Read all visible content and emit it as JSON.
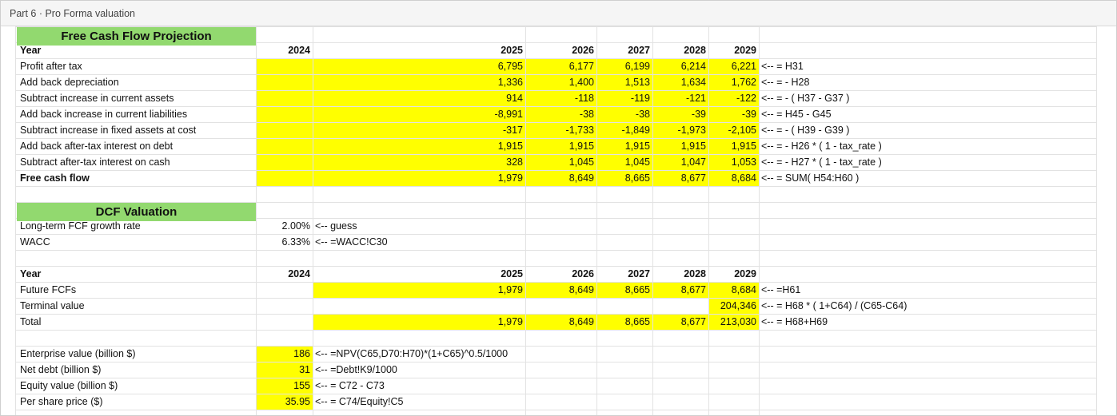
{
  "window": {
    "title": "Part 6 · Pro Forma valuation"
  },
  "fcf": {
    "header": "Free Cash Flow Projection",
    "year_label": "Year",
    "years": [
      "2024",
      "2025",
      "2026",
      "2027",
      "2028",
      "2029"
    ],
    "rows": [
      {
        "label": "Profit after tax",
        "values": [
          "6,795",
          "6,177",
          "6,199",
          "6,214",
          "6,221"
        ],
        "note": "<-- = H31"
      },
      {
        "label": "Add back depreciation",
        "values": [
          "1,336",
          "1,400",
          "1,513",
          "1,634",
          "1,762"
        ],
        "note": "<-- = - H28"
      },
      {
        "label": "Subtract increase in current assets",
        "values": [
          "914",
          "-118",
          "-119",
          "-121",
          "-122"
        ],
        "note": "<-- = - ( H37 - G37 )"
      },
      {
        "label": "Add back increase in current liabilities",
        "values": [
          "-8,991",
          "-38",
          "-38",
          "-39",
          "-39"
        ],
        "note": "<-- = H45 - G45"
      },
      {
        "label": "Subtract increase in fixed assets at cost",
        "values": [
          "-317",
          "-1,733",
          "-1,849",
          "-1,973",
          "-2,105"
        ],
        "note": "<-- = - ( H39 - G39 )"
      },
      {
        "label": "Add back after-tax interest on debt",
        "values": [
          "1,915",
          "1,915",
          "1,915",
          "1,915",
          "1,915"
        ],
        "note": "<-- = - H26 * ( 1 - tax_rate )"
      },
      {
        "label": "Subtract after-tax interest on cash",
        "values": [
          "328",
          "1,045",
          "1,045",
          "1,047",
          "1,053"
        ],
        "note": "<-- = - H27 * ( 1 - tax_rate )"
      },
      {
        "label": "Free cash flow",
        "values": [
          "1,979",
          "8,649",
          "8,665",
          "8,677",
          "8,684"
        ],
        "note": "<-- = SUM( H54:H60 )"
      }
    ]
  },
  "dcf": {
    "header": "DCF Valuation",
    "params": [
      {
        "label": "Long-term FCF growth rate",
        "value": "2.00%",
        "note": "<-- guess"
      },
      {
        "label": "WACC",
        "value": "6.33%",
        "note": "<-- =WACC!C30"
      }
    ],
    "year_label": "Year",
    "years": [
      "2024",
      "2025",
      "2026",
      "2027",
      "2028",
      "2029"
    ],
    "future": {
      "label": "Future FCFs",
      "values": [
        "1,979",
        "8,649",
        "8,665",
        "8,677",
        "8,684"
      ],
      "note": "<-- =H61"
    },
    "terminal": {
      "label": "Terminal value",
      "value": "204,346",
      "note": "<-- = H68 * ( 1+C64) / (C65-C64)"
    },
    "total": {
      "label": "Total",
      "values": [
        "1,979",
        "8,649",
        "8,665",
        "8,677",
        "213,030"
      ],
      "note": "<-- = H68+H69"
    }
  },
  "results": [
    {
      "label": "Enterprise value (billion $)",
      "value": "186",
      "note": "<-- =NPV(C65,D70:H70)*(1+C65)^0.5/1000"
    },
    {
      "label": "Net debt (billion $)",
      "value": "31",
      "note": "<-- =Debt!K9/1000"
    },
    {
      "label": "Equity value (billion $)",
      "value": "155",
      "note": "<-- = C72 - C73"
    },
    {
      "label": "Per share price ($)",
      "value": "35.95",
      "note": "<-- = C74/Equity!C5"
    }
  ]
}
